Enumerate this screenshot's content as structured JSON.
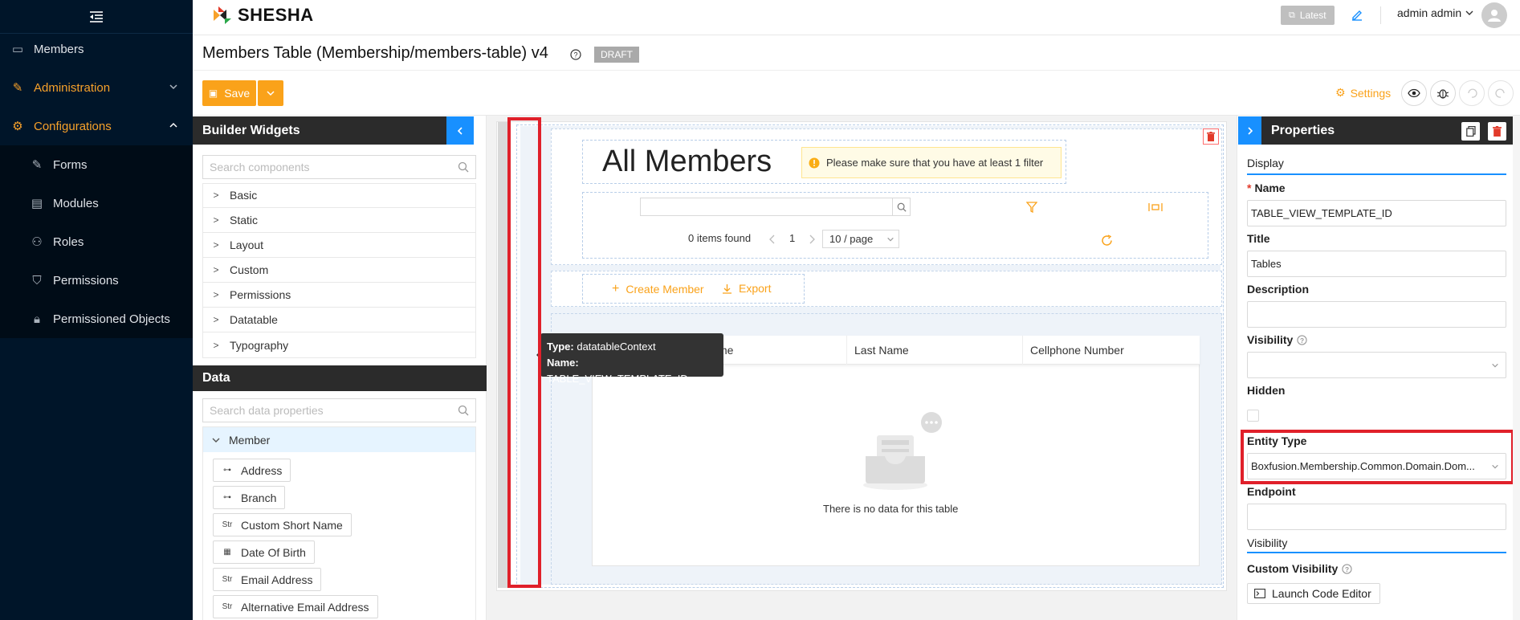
{
  "brand": {
    "name": "SHESHA"
  },
  "topbar": {
    "version_label": "Latest",
    "user_name": "admin admin"
  },
  "sidebar": {
    "items": [
      {
        "label": "Members",
        "icon": "id-card-icon"
      },
      {
        "label": "Administration",
        "icon": "wrench-icon"
      },
      {
        "label": "Configurations",
        "icon": "gear-icon"
      },
      {
        "label": "Forms",
        "icon": "form-icon"
      },
      {
        "label": "Modules",
        "icon": "modules-icon"
      },
      {
        "label": "Roles",
        "icon": "roles-icon"
      },
      {
        "label": "Permissions",
        "icon": "shield-icon"
      },
      {
        "label": "Permissioned Objects",
        "icon": "lock-icon"
      }
    ]
  },
  "page": {
    "title": "Members Table (Membership/members-table) v4",
    "status_badge": "DRAFT"
  },
  "toolbar": {
    "save_label": "Save",
    "settings_label": "Settings"
  },
  "builder": {
    "title": "Builder Widgets",
    "search_placeholder": "Search components",
    "groups": [
      "Basic",
      "Static",
      "Layout",
      "Custom",
      "Permissions",
      "Datatable",
      "Typography"
    ]
  },
  "data_panel": {
    "title": "Data",
    "search_placeholder": "Search data properties",
    "entity": "Member",
    "properties": [
      {
        "label": "Address",
        "icon": "reference-icon"
      },
      {
        "label": "Branch",
        "icon": "reference-icon"
      },
      {
        "label": "Custom Short Name",
        "icon": "string-icon"
      },
      {
        "label": "Date Of Birth",
        "icon": "calendar-icon"
      },
      {
        "label": "Email Address",
        "icon": "string-icon"
      },
      {
        "label": "Alternative Email Address",
        "icon": "string-icon"
      }
    ]
  },
  "canvas": {
    "heading": "All Members",
    "alert": "Please make sure that you have at least 1 filter",
    "items_found": "0 items found",
    "page_number": "1",
    "page_size": "10 / page",
    "create_label": "Create Member",
    "export_label": "Export",
    "tooltip": {
      "type_key": "Type:",
      "type_val": "datatableContext",
      "name_key": "Name:",
      "name_val": "TABLE_VIEW_TEMPLATE_ID"
    },
    "columns": [
      "First Name",
      "Last Name",
      "Cellphone Number"
    ],
    "empty_text": "There is no data for this table"
  },
  "properties": {
    "title": "Properties",
    "section_display": "Display",
    "name_label": "Name",
    "name_value": "TABLE_VIEW_TEMPLATE_ID",
    "title_label": "Title",
    "title_value": "Tables",
    "description_label": "Description",
    "visibility_label": "Visibility",
    "hidden_label": "Hidden",
    "entity_type_label": "Entity Type",
    "entity_type_value": "Boxfusion.Membership.Common.Domain.Dom...",
    "endpoint_label": "Endpoint",
    "section_visibility": "Visibility",
    "custom_visibility_label": "Custom Visibility",
    "launch_label": "Launch Code Editor"
  },
  "colors": {
    "accent": "#faa21a",
    "sidebar_bg": "#001529",
    "panel_header": "#2b2b2b",
    "blue": "#1890ff",
    "highlight": "#e0202a"
  }
}
